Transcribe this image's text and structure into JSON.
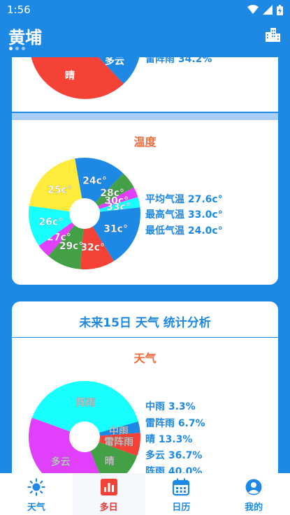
{
  "status": {
    "time": "1:56"
  },
  "header": {
    "city": "黄埔"
  },
  "card_top": {
    "pie_labels": [
      "多云",
      "晴"
    ],
    "legend": [
      "雷阵雨 34.2%"
    ]
  },
  "card_temp": {
    "title": "温度",
    "stats": [
      "平均气温 27.6c°",
      "最高气温 33.0c°",
      "最低气温 24.0c°"
    ]
  },
  "card_forecast": {
    "heading": "未来15日 天气 统计分析",
    "section": "天气",
    "legend": [
      "中雨 3.3%",
      "雷阵雨 6.7%",
      "晴 13.3%",
      "多云 36.7%",
      "阵雨 40.0%"
    ]
  },
  "chart_data": [
    {
      "type": "pie",
      "title": "温度",
      "categories": [
        "24c°",
        "28c°",
        "30c°",
        "33c°",
        "31c°",
        "32c°",
        "29c°",
        "27c°",
        "26c°",
        "25c°"
      ],
      "values": [
        15,
        5,
        3,
        3,
        18,
        10,
        10,
        4,
        12,
        20
      ],
      "colors": [
        "#1e88e5",
        "#43a047",
        "#e040fb",
        "#18ffff",
        "#1e88e5",
        "#f44336",
        "#43a047",
        "#e040fb",
        "#18ffff",
        "#ffeb3b"
      ]
    },
    {
      "type": "pie",
      "title": "天气",
      "categories": [
        "阵雨",
        "中雨",
        "雷阵雨",
        "晴",
        "多云"
      ],
      "values": [
        40.0,
        3.3,
        6.7,
        13.3,
        36.7
      ],
      "colors": [
        "#18ffff",
        "#1e88e5",
        "#f44336",
        "#43a047",
        "#e040fb"
      ]
    }
  ],
  "nav": [
    {
      "label": "天气",
      "icon": "sun-icon"
    },
    {
      "label": "多日",
      "icon": "bar-chart-icon"
    },
    {
      "label": "日历",
      "icon": "calendar-icon"
    },
    {
      "label": "我的",
      "icon": "profile-icon"
    }
  ]
}
